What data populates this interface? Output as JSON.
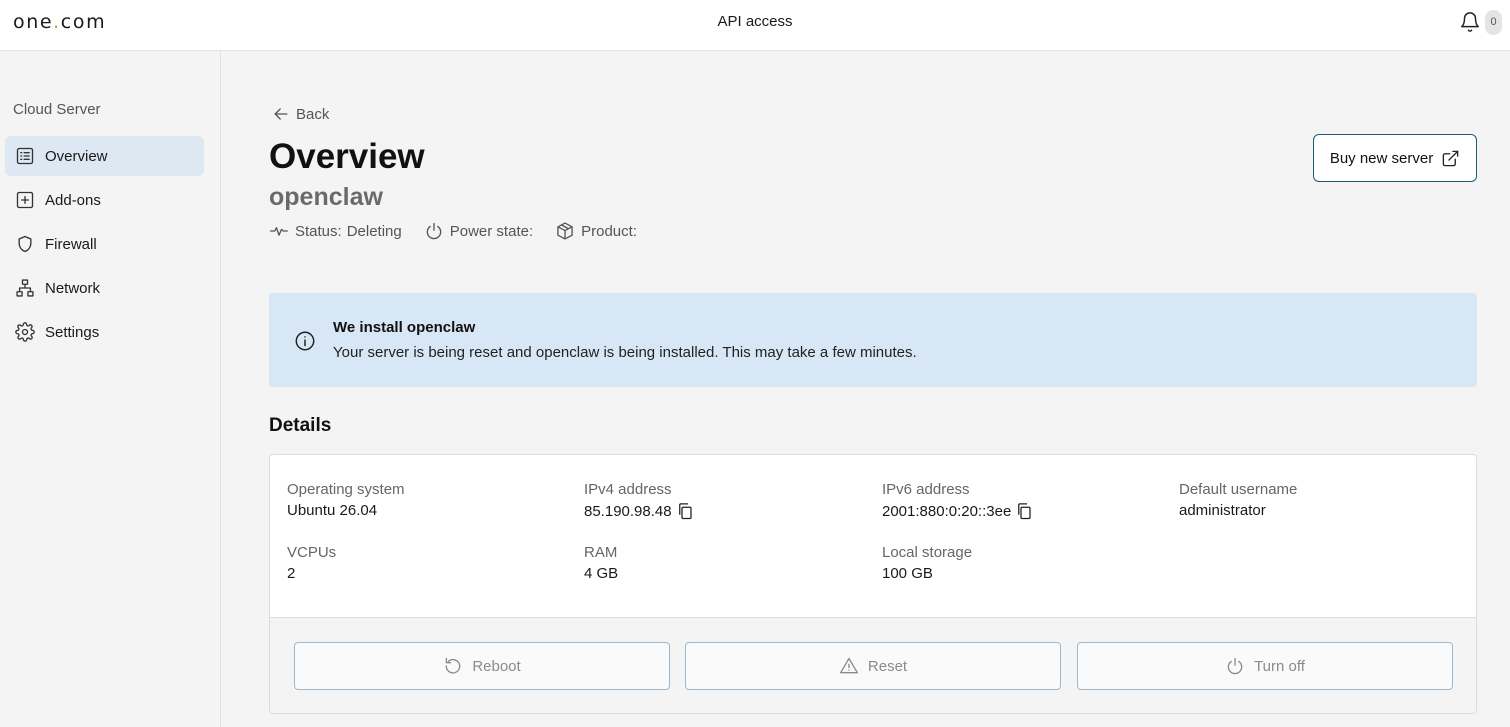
{
  "header": {
    "logo_text_a": "one",
    "logo_dot": ".",
    "logo_text_b": "com",
    "title": "API access",
    "notification_count": "0"
  },
  "sidebar": {
    "heading": "Cloud Server",
    "items": [
      {
        "label": "Overview",
        "icon": "list-icon",
        "active": true
      },
      {
        "label": "Add-ons",
        "icon": "plus-square-icon"
      },
      {
        "label": "Firewall",
        "icon": "shield-icon"
      },
      {
        "label": "Network",
        "icon": "network-icon"
      },
      {
        "label": "Settings",
        "icon": "gear-icon"
      }
    ]
  },
  "main": {
    "back_label": "Back",
    "title": "Overview",
    "server_name": "openclaw",
    "status_label": "Status:",
    "status_value": "Deleting",
    "power_label": "Power state:",
    "product_label": "Product:",
    "buy_button": "Buy new server",
    "notice": {
      "title": "We install openclaw",
      "text": "Your server is being reset and openclaw is being installed. This may take a few minutes."
    },
    "details_heading": "Details",
    "details": {
      "os_label": "Operating system",
      "os_value": "Ubuntu 26.04",
      "ipv4_label": "IPv4 address",
      "ipv4_value": "85.190.98.48",
      "ipv6_label": "IPv6 address",
      "ipv6_value": "2001:880:0:20::3ee",
      "user_label": "Default username",
      "user_value": "administrator",
      "vcpu_label": "VCPUs",
      "vcpu_value": "2",
      "ram_label": "RAM",
      "ram_value": "4 GB",
      "storage_label": "Local storage",
      "storage_value": "100 GB"
    },
    "actions": {
      "reboot": "Reboot",
      "reset": "Reset",
      "turn_off": "Turn off"
    }
  },
  "colors": {
    "accent_dot": "#76b72a",
    "sidebar_active_bg": "#dde8f3",
    "notice_bg": "#d8e7f5",
    "button_border": "#1f5b7a"
  }
}
